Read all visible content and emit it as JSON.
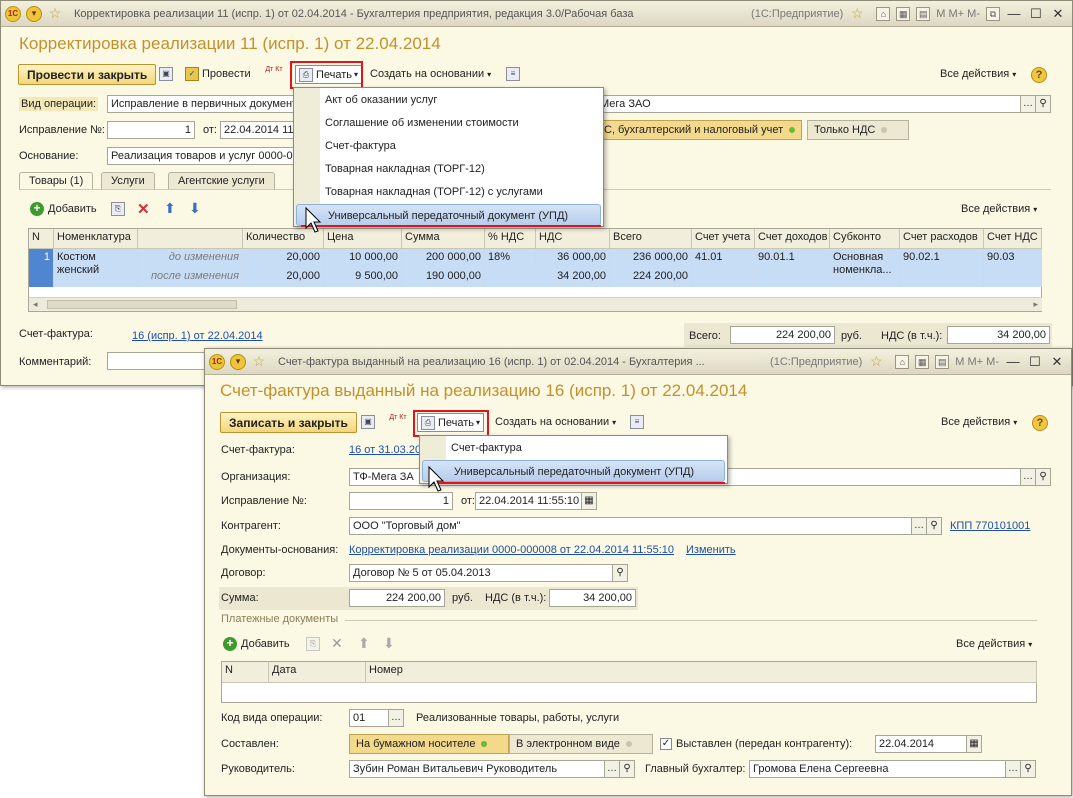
{
  "w1": {
    "title": "Корректировка реализации 11 (испр. 1) от 02.04.2014 - Бухгалтерия предприятия, редакция 3.0/Рабочая база",
    "platform": "(1С:Предприятие)",
    "form_title": "Корректировка реализации 11 (испр. 1) от 22.04.2014",
    "btn_post_close": "Провести и закрыть",
    "btn_post": "Провести",
    "dtkt": "Дт Кт",
    "btn_print": "Печать",
    "btn_create_based": "Создать на основании",
    "all_actions": "Все действия",
    "lbl_op_type": "Вид операции:",
    "op_type": "Исправление в первичных документах",
    "org_tail": "Мега ЗАО",
    "lbl_correction": "Исправление №:",
    "correction_no": "1",
    "lbl_from": "от:",
    "correction_date": "22.04.2014 11:",
    "accounting": "С, бухгалтерский и налоговый учет",
    "vat_only": "Только НДС",
    "lbl_basis": "Основание:",
    "basis": "Реализация товаров и услуг 0000-00",
    "tabs": [
      "Товары (1)",
      "Услуги",
      "Агентские услуги"
    ],
    "btn_add": "Добавить",
    "grid_all_actions": "Все действия",
    "headers": [
      "N",
      "Номенклатура",
      "",
      "Количество",
      "Цена",
      "Сумма",
      "% НДС",
      "НДС",
      "Всего",
      "Счет учета",
      "Счет доходов",
      "Субконто",
      "Счет расходов",
      "Счет НДС"
    ],
    "row": {
      "n": "1",
      "item": "Костюм женский",
      "before": "до изменения",
      "after": "после изменения",
      "qty_before": "20,000",
      "qty_after": "20,000",
      "price_before": "10 000,00",
      "price_after": "9 500,00",
      "sum_before": "200 000,00",
      "sum_after": "190 000,00",
      "vat_rate": "18%",
      "vat_before": "36 000,00",
      "vat_after": "34 200,00",
      "total_before": "236 000,00",
      "total_after": "224 200,00",
      "acc": "41.01",
      "income_acc": "90.01.1",
      "subconto": "Основная номенкла...",
      "expense_acc": "90.02.1",
      "vat_acc": "90.03"
    },
    "lbl_invoice": "Счет-фактура:",
    "invoice_link": "16 (испр. 1) от 22.04.2014",
    "lbl_total": "Всего:",
    "total": "224 200,00",
    "currency": "руб.",
    "lbl_vat_incl": "НДС (в т.ч.):",
    "vat_total": "34 200,00",
    "lbl_comment": "Комментарий:",
    "print_menu": [
      "Акт об оказании услуг",
      "Соглашение об изменении стоимости",
      "Счет-фактура",
      "Товарная накладная (ТОРГ-12)",
      "Товарная накладная (ТОРГ-12) с услугами",
      "Универсальный передаточный документ (УПД)"
    ]
  },
  "w2": {
    "title": "Счет-фактура выданный на реализацию 16 (испр. 1) от 02.04.2014 - Бухгалтерия ...",
    "platform": "(1С:Предприятие)",
    "form_title": "Счет-фактура выданный на реализацию 16 (испр. 1) от 22.04.2014",
    "btn_save_close": "Записать и закрыть",
    "dtkt": "Дт Кт",
    "btn_print": "Печать",
    "btn_create_based": "Создать на основании",
    "all_actions": "Все действия",
    "lbl_invoice": "Счет-фактура:",
    "invoice_link": "16 от 31.03.20",
    "lbl_org": "Организация:",
    "org": "ТФ-Мега ЗА",
    "lbl_correction": "Исправление №:",
    "correction_no": "1",
    "lbl_from": "от:",
    "correction_date": "22.04.2014 11:55:10",
    "lbl_counterparty": "Контрагент:",
    "counterparty": "ООО \"Торговый дом\"",
    "kpp": "КПП 770101001",
    "lbl_base_docs": "Документы-основания:",
    "base_doc_link": "Корректировка реализации 0000-000008 от 22.04.2014 11:55:10",
    "change_link": "Изменить",
    "lbl_contract": "Договор:",
    "contract": "Договор № 5 от 05.04.2013",
    "lbl_sum": "Сумма:",
    "sum": "224 200,00",
    "currency": "руб.",
    "lbl_vat_incl": "НДС (в т.ч.):",
    "vat": "34 200,00",
    "payment_docs": "Платежные документы",
    "btn_add": "Добавить",
    "grid_all_actions": "Все действия",
    "headers": [
      "N",
      "Дата",
      "Номер"
    ],
    "lbl_op_code": "Код вида операции:",
    "op_code": "01",
    "op_code_desc": "Реализованные товары, работы, услуги",
    "lbl_compiled": "Составлен:",
    "paper": "На бумажном носителе",
    "electronic": "В электронном виде",
    "issued": "Выставлен (передан контрагенту):",
    "issued_date": "22.04.2014",
    "lbl_head": "Руководитель:",
    "head": "Зубин Роман Витальевич Руководитель",
    "lbl_chief_acc": "Главный бухгалтер:",
    "chief_acc": "Громова Елена Сергеевна",
    "print_menu": [
      "Счет-фактура",
      "Универсальный передаточный документ (УПД)"
    ]
  }
}
